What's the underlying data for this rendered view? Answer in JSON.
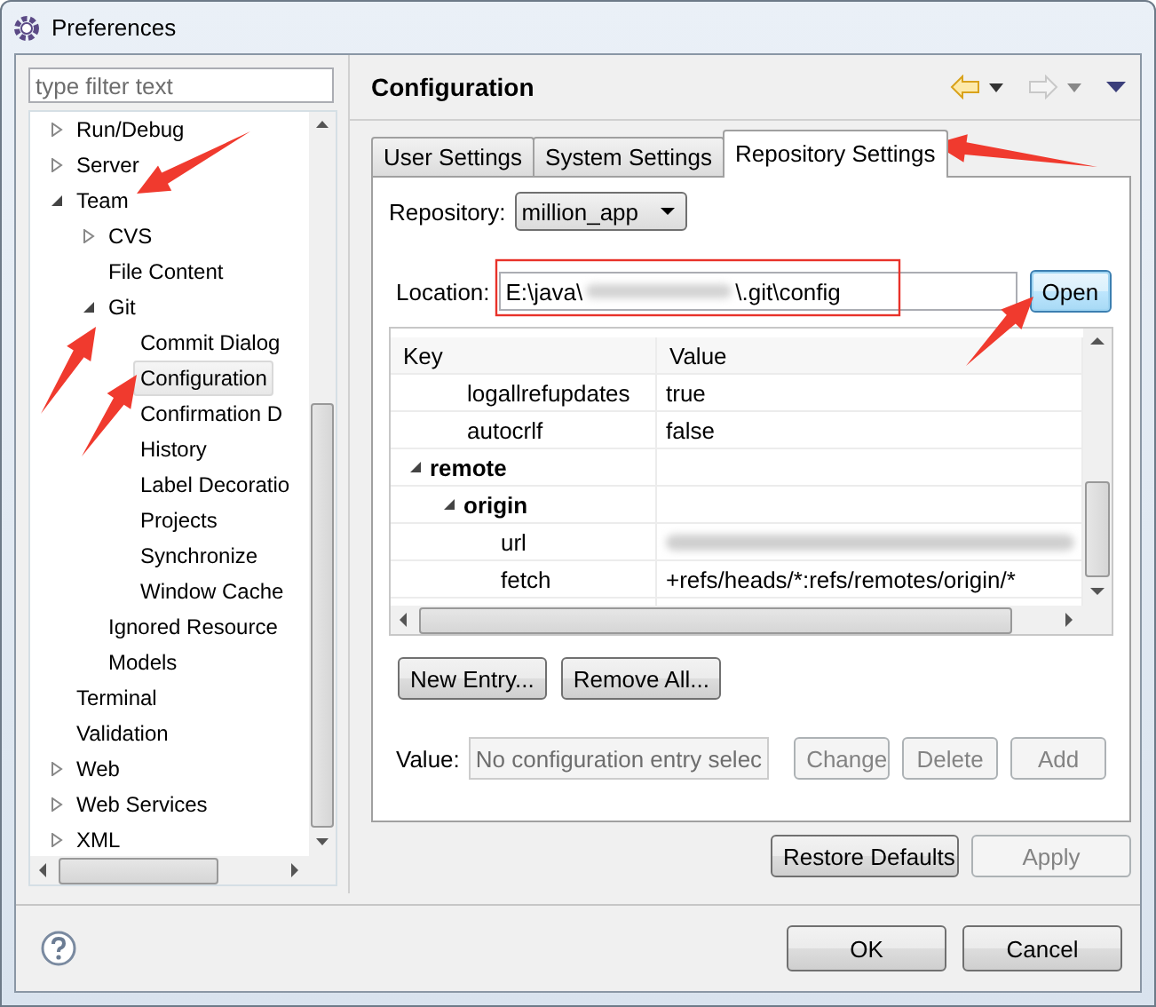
{
  "window": {
    "title": "Preferences"
  },
  "filter": {
    "placeholder": "type filter text"
  },
  "tree": [
    {
      "label": "Run/Debug",
      "expanded": false,
      "selected": false
    },
    {
      "label": "Server",
      "expanded": false,
      "selected": false
    },
    {
      "label": "Team",
      "expanded": true,
      "selected": false,
      "children": [
        {
          "label": "CVS",
          "expanded": false,
          "selected": false
        },
        {
          "label": "File Content",
          "selected": false
        },
        {
          "label": "Git",
          "expanded": true,
          "selected": false,
          "children": [
            {
              "label": "Commit Dialog",
              "selected": false
            },
            {
              "label": "Configuration",
              "selected": true
            },
            {
              "label": "Confirmation D",
              "selected": false
            },
            {
              "label": "History",
              "selected": false
            },
            {
              "label": "Label Decoratio",
              "selected": false
            },
            {
              "label": "Projects",
              "selected": false
            },
            {
              "label": "Synchronize",
              "selected": false
            },
            {
              "label": "Window Cache",
              "selected": false
            }
          ]
        },
        {
          "label": "Ignored Resource",
          "selected": false
        },
        {
          "label": "Models",
          "selected": false
        }
      ]
    },
    {
      "label": "Terminal",
      "selected": false
    },
    {
      "label": "Validation",
      "selected": false
    },
    {
      "label": "Web",
      "expanded": false,
      "selected": false
    },
    {
      "label": "Web Services",
      "expanded": false,
      "selected": false
    },
    {
      "label": "XML",
      "expanded": false,
      "selected": false
    }
  ],
  "page": {
    "title": "Configuration",
    "back": {
      "disabled": false
    },
    "forward": {
      "disabled": true
    }
  },
  "tabs": [
    {
      "label": "User Settings",
      "selected": false
    },
    {
      "label": "System Settings",
      "selected": false
    },
    {
      "label": "Repository Settings",
      "selected": true
    }
  ],
  "repository": {
    "label": "Repository:",
    "value": "million_app"
  },
  "location": {
    "label": "Location:",
    "value_start": "E:\\java\\",
    "value_end": "\\.git\\config",
    "blurred": true
  },
  "open_button": {
    "label": "Open",
    "focused": true
  },
  "table": {
    "columns": [
      "Key",
      "Value"
    ],
    "rows": [
      {
        "kind": "continued",
        "children": [
          {
            "kind": "entry",
            "key": "logallrefupdates",
            "value": "true"
          },
          {
            "kind": "entry",
            "key": "autocrlf",
            "value": "false"
          }
        ]
      },
      {
        "kind": "section",
        "key": "remote",
        "expanded": true,
        "children": [
          {
            "kind": "section",
            "key": "origin",
            "expanded": true,
            "children": [
              {
                "kind": "entry",
                "key": "url",
                "blurred": true
              },
              {
                "kind": "entry",
                "key": "fetch",
                "value": "+refs/heads/*:refs/remotes/origin/*"
              }
            ]
          }
        ]
      }
    ]
  },
  "entry_buttons": [
    {
      "label": "New Entry...",
      "disabled": false
    },
    {
      "label": "Remove All...",
      "disabled": false
    }
  ],
  "value": {
    "label": "Value:",
    "placeholder": "No configuration entry selec",
    "disabled": true
  },
  "value_buttons": [
    {
      "label": "Change",
      "disabled": true
    },
    {
      "label": "Delete",
      "disabled": true
    },
    {
      "label": "Add",
      "disabled": true
    }
  ],
  "page_buttons": [
    {
      "label": "Restore Defaults",
      "disabled": false
    },
    {
      "label": "Apply",
      "disabled": true
    }
  ],
  "dialog_buttons": [
    {
      "label": "OK",
      "disabled": false
    },
    {
      "label": "Cancel",
      "disabled": false
    }
  ]
}
